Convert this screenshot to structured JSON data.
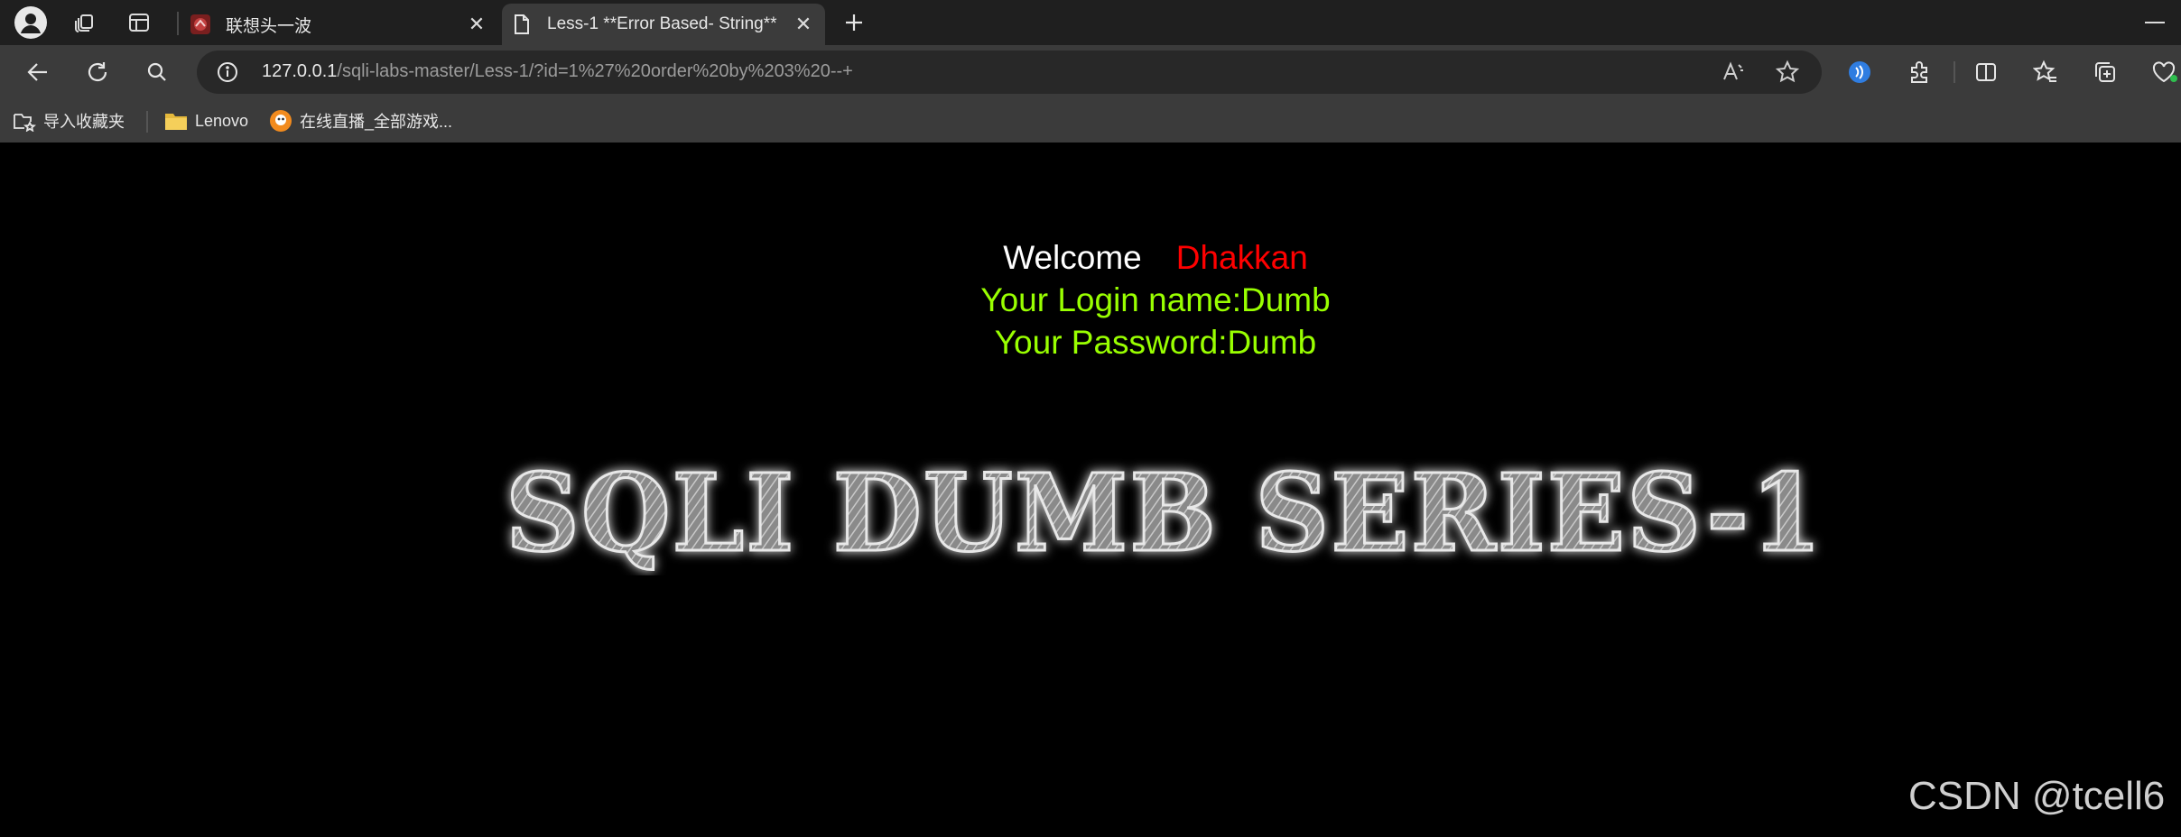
{
  "browser": {
    "tabs": [
      {
        "title": "联想头一波",
        "active": false,
        "favicon": "lenovo-favicon-icon"
      },
      {
        "title": "Less-1 **Error Based- String**",
        "active": true,
        "favicon": "document-icon"
      }
    ],
    "address": {
      "host": "127.0.0.1",
      "path": "/sqli-labs-master/Less-1/?id=1%27%20order%20by%203%20--+"
    },
    "bookmarks": [
      {
        "label": "导入收藏夹",
        "icon": "import-favorites-icon"
      },
      {
        "label": "Lenovo",
        "icon": "folder-icon"
      },
      {
        "label": "在线直播_全部游戏...",
        "icon": "live-stream-icon"
      }
    ],
    "colors": {
      "tabbar": "#1f1f1f",
      "toolbar": "#3b3b3b",
      "omnibox": "#282828"
    }
  },
  "page": {
    "welcome": "Welcome",
    "user": "Dhakkan",
    "login_line": "Your Login name:Dumb",
    "password_line": "Your Password:Dumb",
    "banner": "SQLI DUMB SERIES-1",
    "colors": {
      "welcome": "#ffffff",
      "user": "#ff0000",
      "info": "#99ff00",
      "background": "#000000"
    }
  },
  "watermark": "CSDN @tcell6"
}
